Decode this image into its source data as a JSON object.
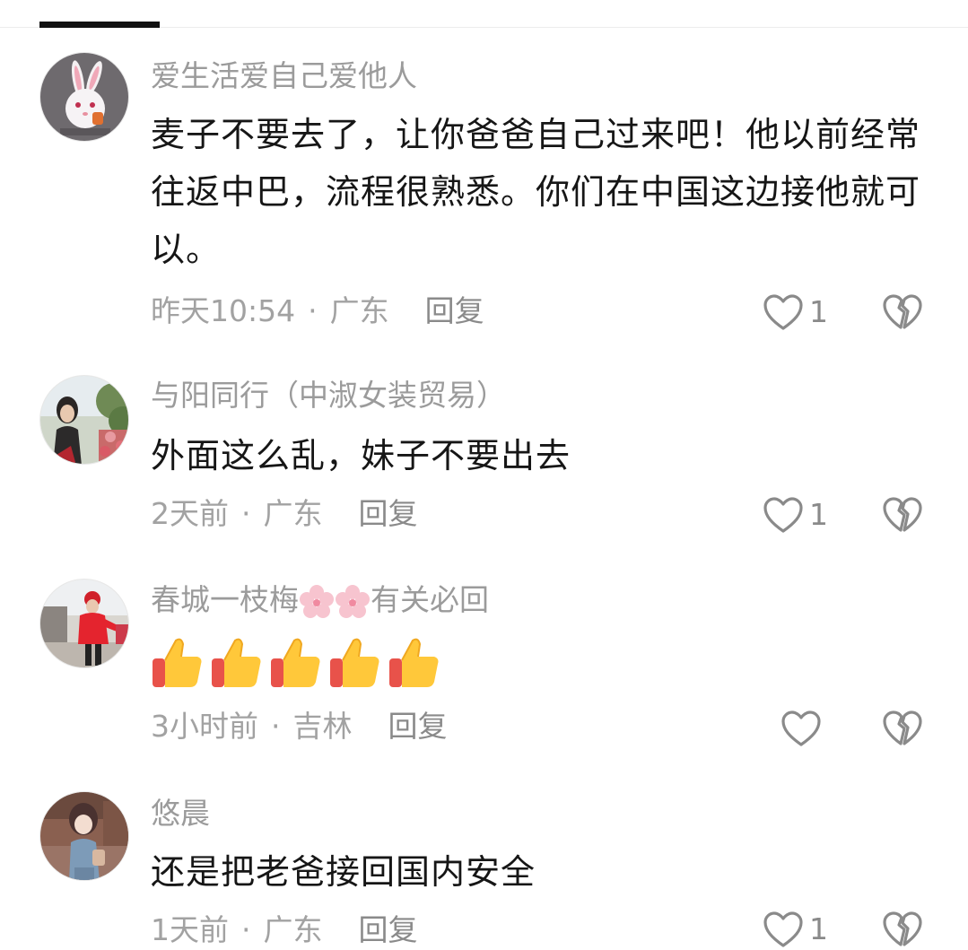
{
  "tabs": {
    "active_indicator": "active-tab"
  },
  "colors": {
    "username": "#9b9b9b",
    "content": "#161616",
    "meta": "#a2a2a2",
    "icon": "#8a8a8a"
  },
  "comments": [
    {
      "username": "爱生活爱自己爱他人",
      "content": "麦子不要去了，让你爸爸自己过来吧！他以前经常往返中巴，流程很熟悉。你们在中国这边接他就可以。",
      "time": "昨天10:54",
      "separator": "·",
      "location": "广东",
      "reply": "回复",
      "likes": "1",
      "avatar_icon": "rabbit-avatar"
    },
    {
      "username": "与阳同行（中淑女装贸易）",
      "content": "外面这么乱，妹子不要出去",
      "time": "2天前",
      "separator": "·",
      "location": "广东",
      "reply": "回复",
      "likes": "1",
      "avatar_icon": "woman-outdoor-avatar"
    },
    {
      "username_prefix": "春城一枝梅",
      "username_suffix": "有关必回",
      "username_emoji": "cherry-blossom-icon",
      "content_emoji": "thumbs-up-icon",
      "content_emoji_count": 5,
      "time": "3小时前",
      "separator": "·",
      "location": "吉林",
      "reply": "回复",
      "likes": "",
      "avatar_icon": "woman-red-coat-avatar"
    },
    {
      "username": "悠晨",
      "content": "还是把老爸接回国内安全",
      "time": "1天前",
      "separator": "·",
      "location": "广东",
      "reply": "回复",
      "likes": "1",
      "avatar_icon": "anime-girl-avatar"
    }
  ]
}
